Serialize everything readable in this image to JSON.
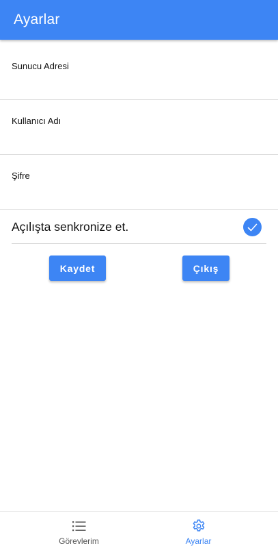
{
  "header": {
    "title": "Ayarlar"
  },
  "form": {
    "server": {
      "label": "Sunucu Adresi",
      "value": ""
    },
    "username": {
      "label": "Kullanıcı Adı",
      "value": ""
    },
    "password": {
      "label": "Şifre",
      "value": ""
    }
  },
  "sync": {
    "label": "Açılışta senkronize et.",
    "checked": true
  },
  "buttons": {
    "save": "Kaydet",
    "exit": "Çıkış"
  },
  "nav": {
    "items": [
      {
        "label": "Görevlerim",
        "icon": "list-icon",
        "active": false
      },
      {
        "label": "Ayarlar",
        "icon": "gear-icon",
        "active": true
      }
    ]
  },
  "colors": {
    "accent": "#3d85f4",
    "inactive": "#555555",
    "divider": "#dcdcdc"
  }
}
